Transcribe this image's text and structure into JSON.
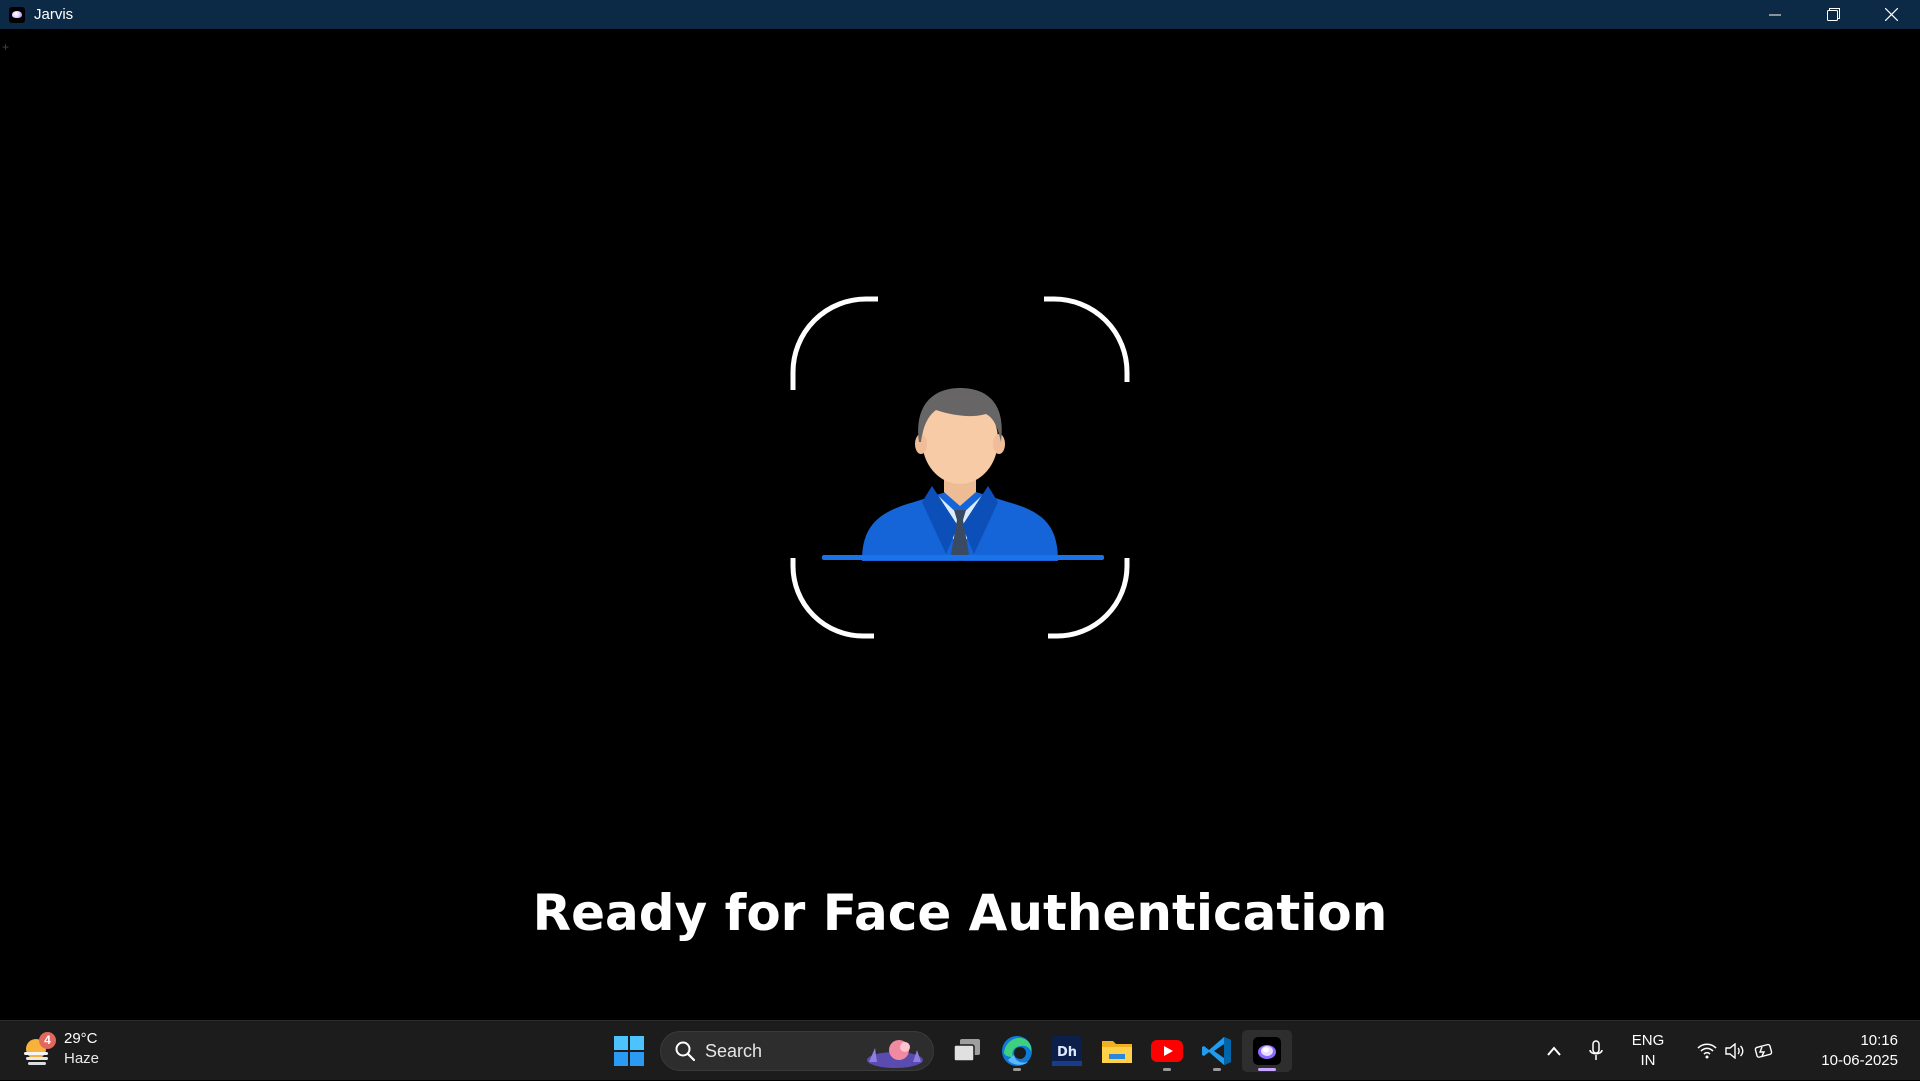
{
  "window": {
    "title": "Jarvis",
    "controls": [
      "minimize-icon",
      "restore-icon",
      "close-icon"
    ]
  },
  "main": {
    "status_text": "Ready for Face Authentication",
    "illustration": "user-avatar-icon"
  },
  "taskbar": {
    "weather": {
      "badge": "4",
      "temperature": "29°C",
      "condition": "Haze"
    },
    "search": {
      "label": "Search"
    },
    "apps": [
      {
        "name": "task-view-icon"
      },
      {
        "name": "edge-icon"
      },
      {
        "name": "dh-app-icon"
      },
      {
        "name": "file-explorer-icon"
      },
      {
        "name": "youtube-icon"
      },
      {
        "name": "vscode-icon"
      },
      {
        "name": "jarvis-icon"
      }
    ],
    "tray": {
      "lang_primary": "ENG",
      "lang_secondary": "IN",
      "time": "10:16",
      "date": "10-06-2025"
    }
  },
  "colors": {
    "titlebar": "#0c2a45",
    "background": "#000000",
    "taskbar": "#1c1c1c",
    "suit_blue": "#1565d8",
    "scan_line": "#1a73e8"
  }
}
